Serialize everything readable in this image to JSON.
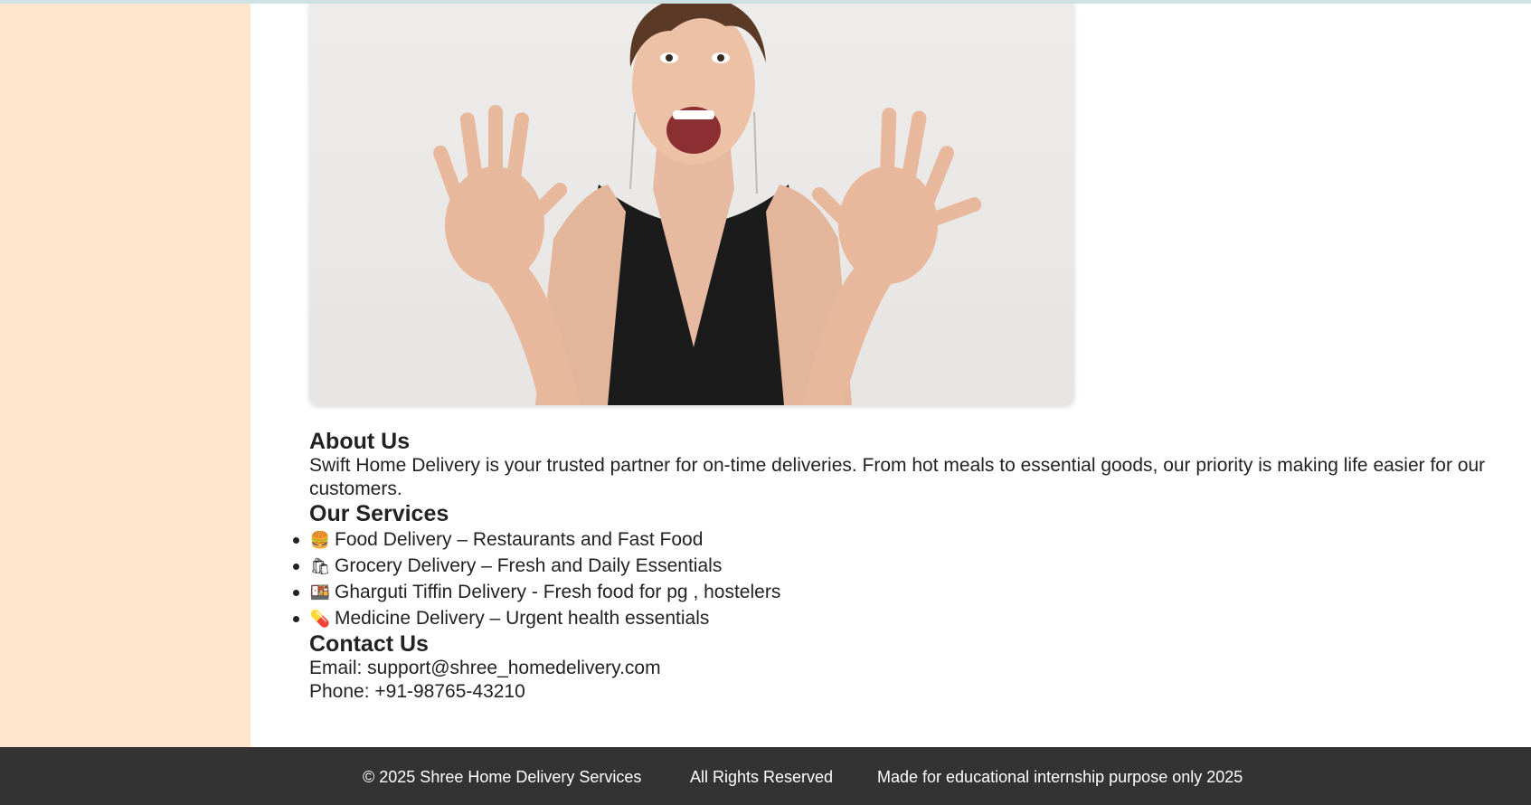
{
  "hero": {
    "image_alt": "excited woman with raised hands"
  },
  "about": {
    "heading": "About Us",
    "text": "Swift Home Delivery is your trusted partner for on-time deliveries. From hot meals to essential goods, our priority is making life easier for our customers."
  },
  "services": {
    "heading": "Our Services",
    "items": [
      {
        "icon": "burger-icon",
        "glyph": "🍔",
        "label": "Food Delivery – Restaurants and Fast Food"
      },
      {
        "icon": "grocery-icon",
        "glyph": "🛍",
        "label": "Grocery Delivery – Fresh and Daily Essentials"
      },
      {
        "icon": "tiffin-icon",
        "glyph": "🍱",
        "label": "Gharguti Tiffin Delivery - Fresh food for pg , hostelers"
      },
      {
        "icon": "pill-icon",
        "glyph": "💊",
        "label": "Medicine Delivery – Urgent health essentials"
      }
    ]
  },
  "contact": {
    "heading": "Contact Us",
    "email": "Email: support@shree_homedelivery.com",
    "phone": "Phone: +91-98765-43210"
  },
  "footer": {
    "copyright": "© 2025 Shree Home Delivery Services",
    "rights": "All Rights Reserved",
    "note": "Made for educational internship purpose only 2025"
  },
  "colors": {
    "sidebar": "#ffe6cd",
    "footer": "#333333",
    "topbar": "#cfe3e6"
  }
}
